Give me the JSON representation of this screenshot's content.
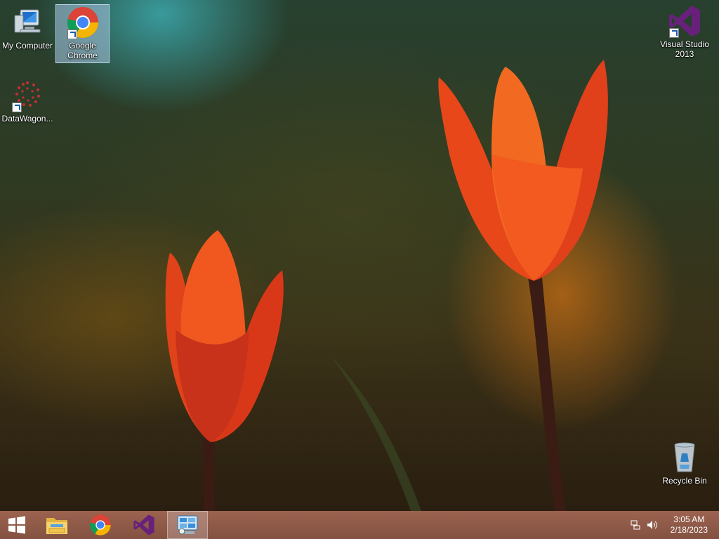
{
  "desktop": {
    "icons": [
      {
        "label": "My Computer",
        "icon": "my-computer-icon"
      },
      {
        "label": "Google\nChrome",
        "icon": "chrome-icon"
      },
      {
        "label": "DataWagon...",
        "icon": "datawagon-icon"
      },
      {
        "label": "Visual Studio\n2013",
        "icon": "visual-studio-icon"
      },
      {
        "label": "Recycle Bin",
        "icon": "recycle-bin-icon"
      }
    ]
  },
  "taskbar": {
    "items": [
      "start-icon",
      "file-explorer-icon",
      "chrome-icon",
      "visual-studio-icon",
      "control-panel-icon"
    ],
    "active_item": "control-panel-icon",
    "tray_icons": [
      "network-icon",
      "volume-icon"
    ],
    "clock": {
      "time": "3:05 AM",
      "date": "2/18/2023"
    }
  },
  "colors": {
    "taskbar": "#8a5240",
    "selection": "#aac8e6"
  }
}
